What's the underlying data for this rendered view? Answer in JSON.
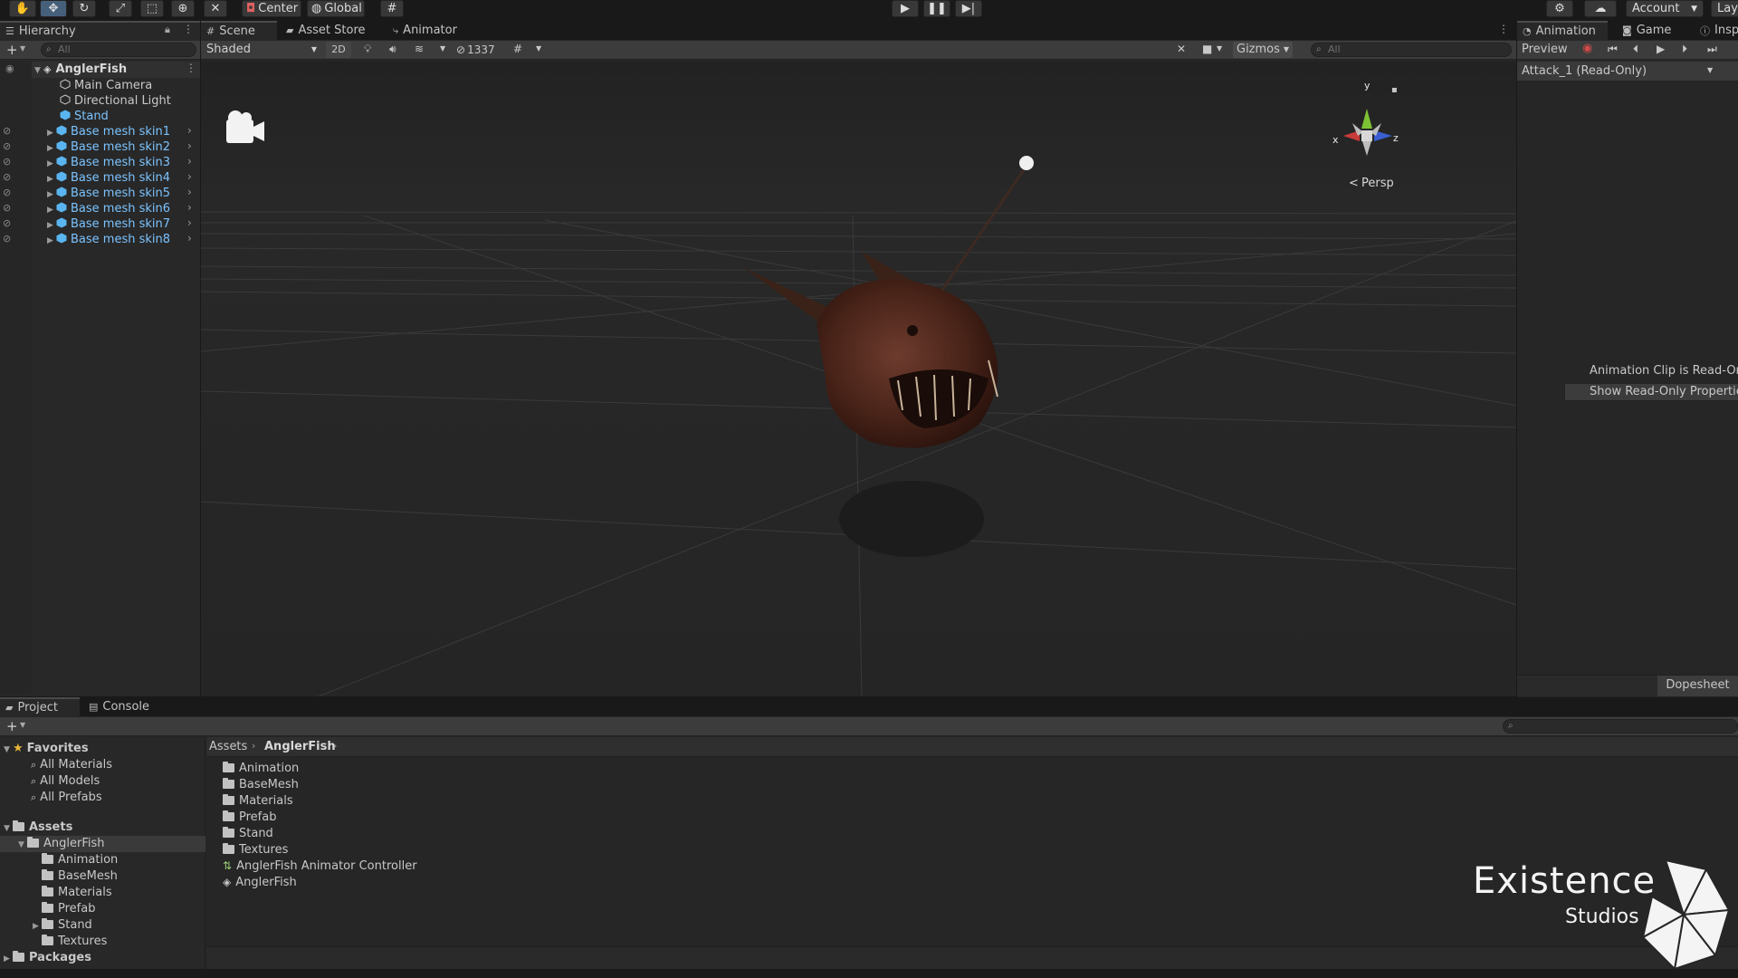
{
  "toolbar": {
    "center_label": "Center",
    "global_label": "Global",
    "account_label": "Account",
    "layers_label": "Lay"
  },
  "hierarchy": {
    "tab_label": "Hierarchy",
    "search_placeholder": "All",
    "root": "AnglerFish",
    "items": [
      {
        "label": "Main Camera",
        "prefab": false
      },
      {
        "label": "Directional Light",
        "prefab": false
      },
      {
        "label": "Stand",
        "prefab": true
      },
      {
        "label": "Base mesh skin1",
        "prefab": true
      },
      {
        "label": "Base mesh skin2",
        "prefab": true
      },
      {
        "label": "Base mesh skin3",
        "prefab": true
      },
      {
        "label": "Base mesh skin4",
        "prefab": true
      },
      {
        "label": "Base mesh skin5",
        "prefab": true
      },
      {
        "label": "Base mesh skin6",
        "prefab": true
      },
      {
        "label": "Base mesh skin7",
        "prefab": true
      },
      {
        "label": "Base mesh skin8",
        "prefab": true
      }
    ]
  },
  "scene": {
    "tabs": [
      "Scene",
      "Asset Store",
      "Animator"
    ],
    "shading_mode": "Shaded",
    "mode_2d": "2D",
    "hidden_count": "1337",
    "gizmos_label": "Gizmos",
    "search_placeholder": "All",
    "axis_y": "y",
    "axis_x": "x",
    "axis_z": "z",
    "persp_label": "Persp"
  },
  "animation": {
    "tabs": [
      "Animation",
      "Game",
      "Insp"
    ],
    "preview_label": "Preview",
    "clip": "Attack_1 (Read-Only)",
    "readonly_notice": "Animation Clip is Read-Onl",
    "show_readonly_button": "Show Read-Only Propertie",
    "dopesheet_label": "Dopesheet"
  },
  "project": {
    "tabs": [
      "Project",
      "Console"
    ],
    "favorites_label": "Favorites",
    "favorites": [
      "All Materials",
      "All Models",
      "All Prefabs"
    ],
    "assets_label": "Assets",
    "anglerfish_label": "AnglerFish",
    "tree_children": [
      "Animation",
      "BaseMesh",
      "Materials",
      "Prefab",
      "Stand",
      "Textures"
    ],
    "packages_label": "Packages",
    "breadcrumb": [
      "Assets",
      "AnglerFish"
    ],
    "files": [
      {
        "label": "Animation",
        "kind": "folder"
      },
      {
        "label": "BaseMesh",
        "kind": "folder"
      },
      {
        "label": "Materials",
        "kind": "folder"
      },
      {
        "label": "Prefab",
        "kind": "folder"
      },
      {
        "label": "Stand",
        "kind": "folder"
      },
      {
        "label": "Textures",
        "kind": "folder"
      },
      {
        "label": "AnglerFish Animator Controller",
        "kind": "controller"
      },
      {
        "label": "AnglerFish",
        "kind": "prefab"
      }
    ]
  },
  "watermark": {
    "line1": "Existence",
    "line2": "Studios"
  },
  "colors": {
    "prefab_blue": "#7bc3ff",
    "panel_bg": "#282828",
    "scene_bg": "#262626",
    "play_active": "#46607c"
  }
}
